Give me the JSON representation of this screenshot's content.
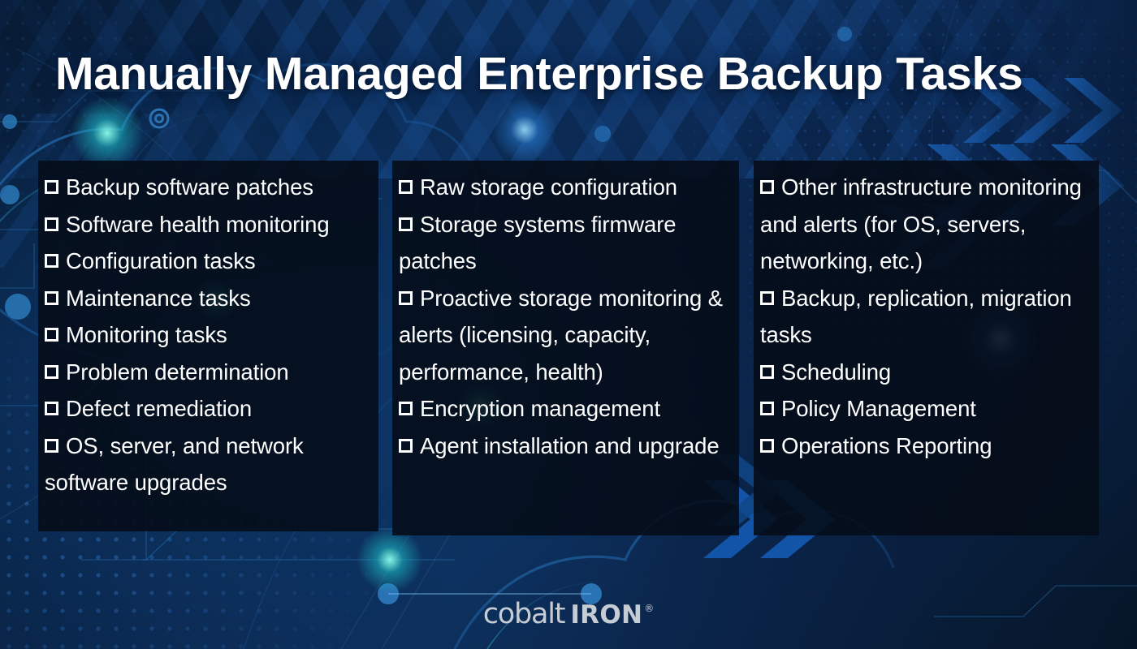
{
  "slide": {
    "title": "Manually Managed Enterprise Backup Tasks",
    "background_color": "#0a2249",
    "panel_color": "#040b17",
    "text_color": "#ffffff",
    "accent_color": "#1e5ca8"
  },
  "columns": [
    {
      "id": "column-1",
      "items": [
        "Backup software patches",
        "Software health monitoring",
        "Configuration tasks",
        "Maintenance tasks",
        "Monitoring tasks",
        "Problem determination",
        "Defect remediation",
        "OS, server, and network software upgrades"
      ]
    },
    {
      "id": "column-2",
      "items": [
        "Raw storage configuration",
        "Storage systems firmware patches",
        "Proactive storage monitoring & alerts (licensing, capacity, performance, health)",
        "Encryption management",
        "Agent installation and upgrade"
      ]
    },
    {
      "id": "column-3",
      "items": [
        "Other infrastructure monitoring and alerts (for OS, servers, networking, etc.)",
        "Backup, replication, migration tasks",
        "Scheduling",
        "Policy Management",
        "Operations Reporting"
      ]
    }
  ],
  "logo": {
    "word_1": "cobalt",
    "word_2": "IRON",
    "trademark": "®",
    "color": "#c6ccd4"
  }
}
